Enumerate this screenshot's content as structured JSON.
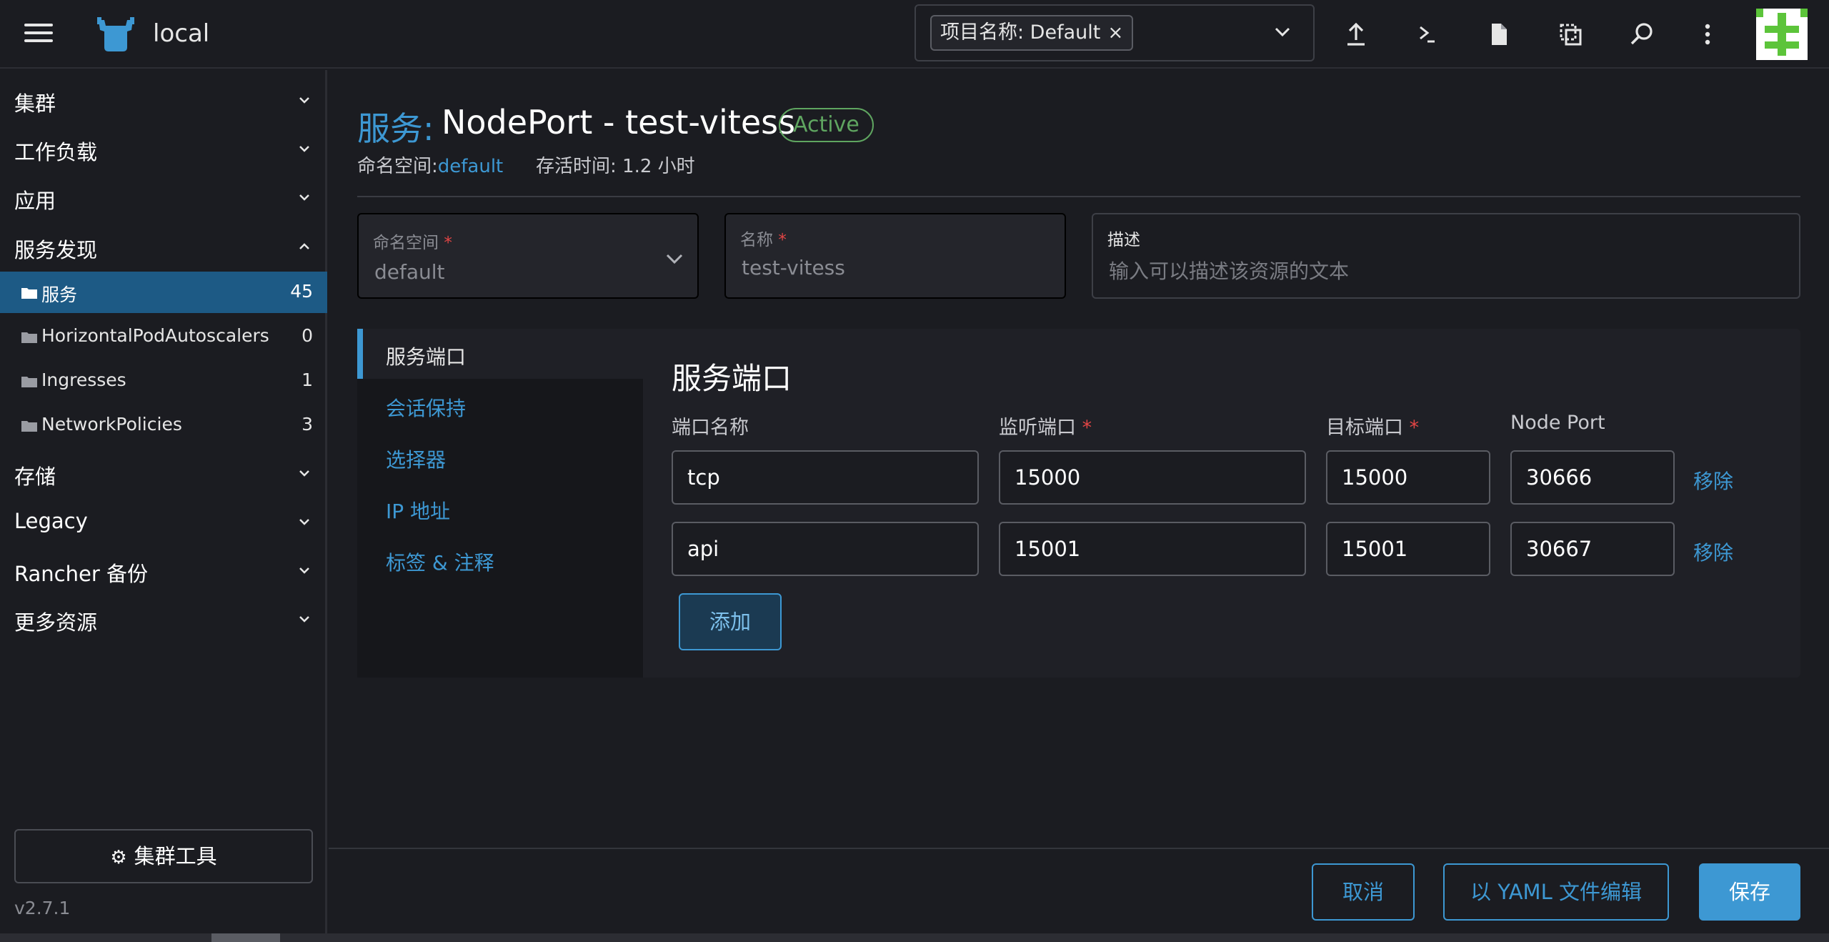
{
  "header": {
    "cluster_name": "local",
    "namespace_chip": "项目名称: Default",
    "chip_close": "×"
  },
  "sidebar": {
    "groups_top": [
      {
        "label": "集群"
      },
      {
        "label": "工作负载"
      },
      {
        "label": "应用"
      },
      {
        "label": "服务发现"
      }
    ],
    "items": [
      {
        "label": "服务",
        "count": "45"
      },
      {
        "label": "HorizontalPodAutoscalers",
        "count": "0"
      },
      {
        "label": "Ingresses",
        "count": "1"
      },
      {
        "label": "NetworkPolicies",
        "count": "3"
      }
    ],
    "groups_bottom": [
      {
        "label": "存储"
      },
      {
        "label": "Legacy"
      },
      {
        "label": "Rancher 备份"
      },
      {
        "label": "更多资源"
      }
    ],
    "tools_label": "集群工具",
    "version": "v2.7.1"
  },
  "page": {
    "title_prefix": "服务:",
    "title_name": "NodePort - test-vitess",
    "status": "Active",
    "ns_label": "命名空间:",
    "ns_value": "default",
    "age_label": "存活时间: 1.2 小时"
  },
  "form": {
    "namespace": {
      "label": "命名空间",
      "value": "default"
    },
    "name": {
      "label": "名称",
      "value": "test-vitess"
    },
    "description": {
      "label": "描述",
      "placeholder": "输入可以描述该资源的文本"
    },
    "required_mark": "*"
  },
  "tabs": [
    {
      "label": "服务端口"
    },
    {
      "label": "会话保持"
    },
    {
      "label": "选择器"
    },
    {
      "label": "IP 地址"
    },
    {
      "label": "标签 & 注释"
    }
  ],
  "ports": {
    "title": "服务端口",
    "headers": {
      "name": "端口名称",
      "listen": "监听端口",
      "target": "目标端口",
      "nodeport": "Node Port"
    },
    "rows": [
      {
        "name": "tcp",
        "listen": "15000",
        "target": "15000",
        "nodeport": "30666",
        "remove": "移除"
      },
      {
        "name": "api",
        "listen": "15001",
        "target": "15001",
        "nodeport": "30667",
        "remove": "移除"
      }
    ],
    "add_label": "添加"
  },
  "footer": {
    "cancel": "取消",
    "edit_yaml": "以 YAML 文件编辑",
    "save": "保存"
  },
  "colors": {
    "accent": "#3d98d3",
    "active_badge": "#5fa560",
    "sidebar_active": "#1d5a85",
    "required": "#e24545"
  },
  "icons": {
    "header": [
      "upload-icon",
      "terminal-icon",
      "file-icon",
      "copy-icon",
      "search-icon",
      "more-vertical-icon"
    ]
  }
}
